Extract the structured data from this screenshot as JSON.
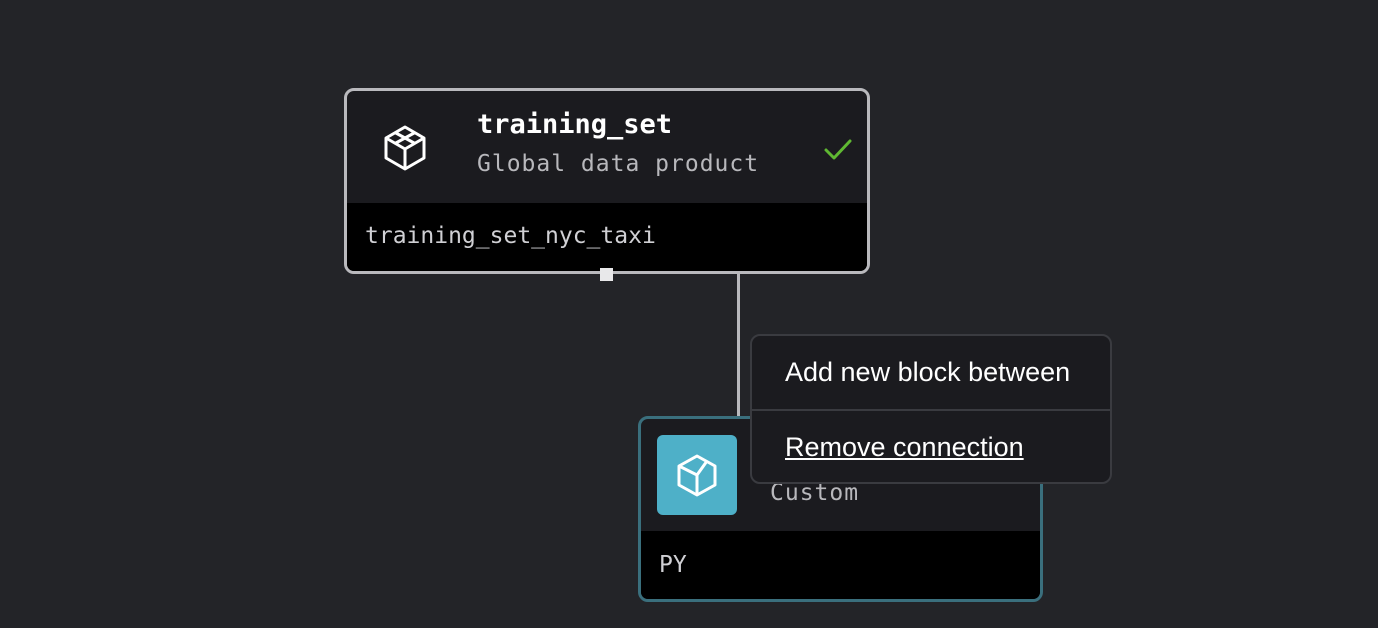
{
  "nodes": {
    "upstream": {
      "title": "training_set",
      "subtitle": "Global data product",
      "footer": "training_set_nyc_taxi",
      "icon": "cube-outline-icon",
      "status_icon": "check-icon",
      "status_color": "#5fb832",
      "border_color": "#b9b9bd"
    },
    "downstream": {
      "subtitle": "Custom",
      "footer": "PY",
      "icon": "custom-block-icon",
      "badge_color": "#4eb0c8",
      "border_color": "#3a6f7d"
    }
  },
  "context_menu": {
    "items": [
      {
        "label": "Add new block between"
      },
      {
        "label": "Remove connection"
      }
    ]
  },
  "colors": {
    "canvas_background": "#232428",
    "node_background": "#1b1b1f",
    "footer_background": "#000000"
  }
}
